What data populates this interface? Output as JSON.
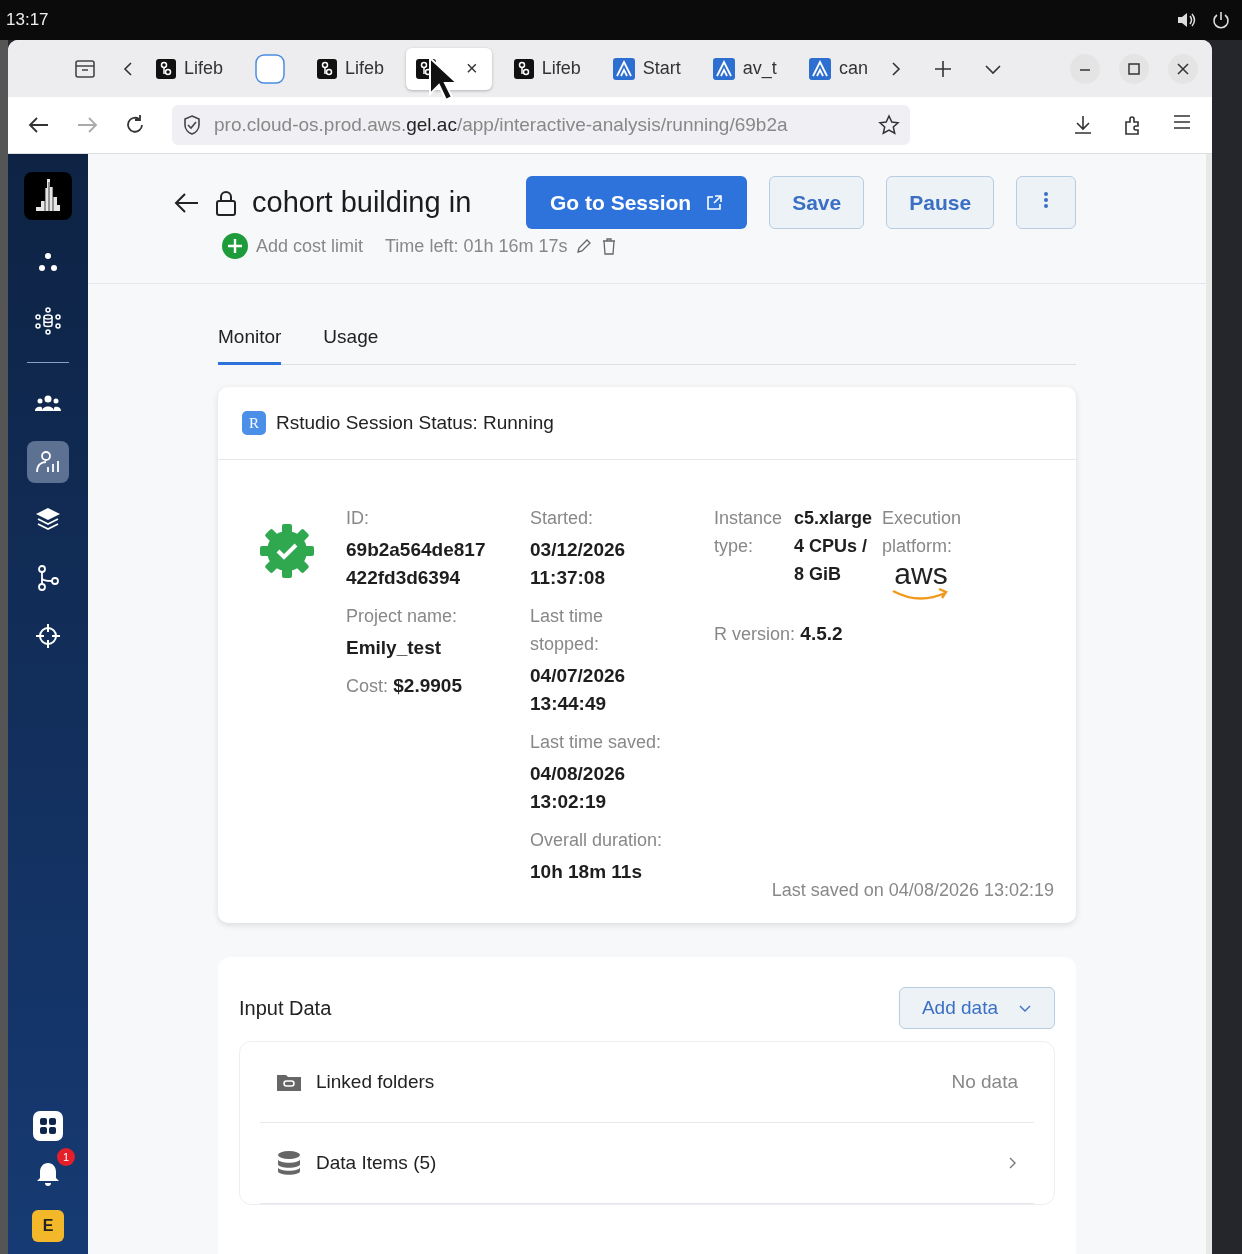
{
  "system_bar": {
    "time": "13:17"
  },
  "browser": {
    "tabs": [
      {
        "kind": "app",
        "label": "Lifeb",
        "selected": false
      },
      {
        "kind": "blank",
        "selected": false
      },
      {
        "kind": "app",
        "label": "Lifeb",
        "selected": false
      },
      {
        "kind": "app",
        "selected": true,
        "close": "×"
      },
      {
        "kind": "app",
        "label": "Lifeb",
        "selected": false
      },
      {
        "kind": "atlas",
        "label": "Start",
        "selected": false
      },
      {
        "kind": "atlas",
        "label": "av_t",
        "selected": false
      },
      {
        "kind": "atlas",
        "label": "can",
        "selected": false
      }
    ],
    "address": {
      "prefix": "pro.cloud-os.prod.aws.",
      "domain": "gel.ac",
      "path": "/app/interactive-analysis/running/69b2a"
    }
  },
  "sidebar": {
    "items": [
      {
        "kind": "dots",
        "selected": false
      },
      {
        "kind": "network",
        "selected": false
      },
      {
        "kind": "people",
        "selected": false
      },
      {
        "kind": "analysis",
        "selected": true
      },
      {
        "kind": "layers",
        "selected": false
      },
      {
        "kind": "branch",
        "selected": false
      },
      {
        "kind": "target",
        "selected": false
      }
    ],
    "notification_count": "1",
    "avatar": "E"
  },
  "header": {
    "title": "cohort building in",
    "go_button": "Go to Session",
    "save_button": "Save",
    "pause_button": "Pause",
    "cost_limit": "Add cost limit",
    "time_left": "Time left: 01h 16m 17s"
  },
  "tabs": [
    {
      "label": "Monitor",
      "selected": true
    },
    {
      "label": "Usage",
      "selected": false
    }
  ],
  "status_card": {
    "badge": "R",
    "title": "Rstudio Session Status: Running",
    "columns": [
      [
        {
          "label": "ID:",
          "value": "69b2a564de817 422fd3d6394"
        },
        {
          "label": "Project name:",
          "value": "Emily_test"
        },
        {
          "label": "Cost:",
          "value": "$2.9905",
          "kind": "inline"
        }
      ],
      [
        {
          "label": "Started:",
          "value": "03/12/2026 11:37:08"
        },
        {
          "label": "Last time stopped:",
          "value": "04/07/2026 13:44:49"
        },
        {
          "label": "Last time saved:",
          "value": "04/08/2026 13:02:19"
        },
        {
          "label": "Overall duration:",
          "value": "10h 18m 11s"
        }
      ]
    ],
    "instance_label": "Instance type:",
    "instance_value": "c5.xlarge 4 CPUs / 8 GiB",
    "platform_label": "Execution platform:",
    "platform_logo": "aws",
    "r_version_label": "R version:",
    "r_version": "4.5.2",
    "last_saved": "Last saved on 04/08/2026 13:02:19"
  },
  "input_data": {
    "title": "Input Data",
    "add_button": "Add data",
    "rows": [
      {
        "kind": "folder",
        "label": "Linked folders",
        "status": "No data"
      },
      {
        "kind": "database",
        "label": "Data Items (5)"
      }
    ]
  }
}
